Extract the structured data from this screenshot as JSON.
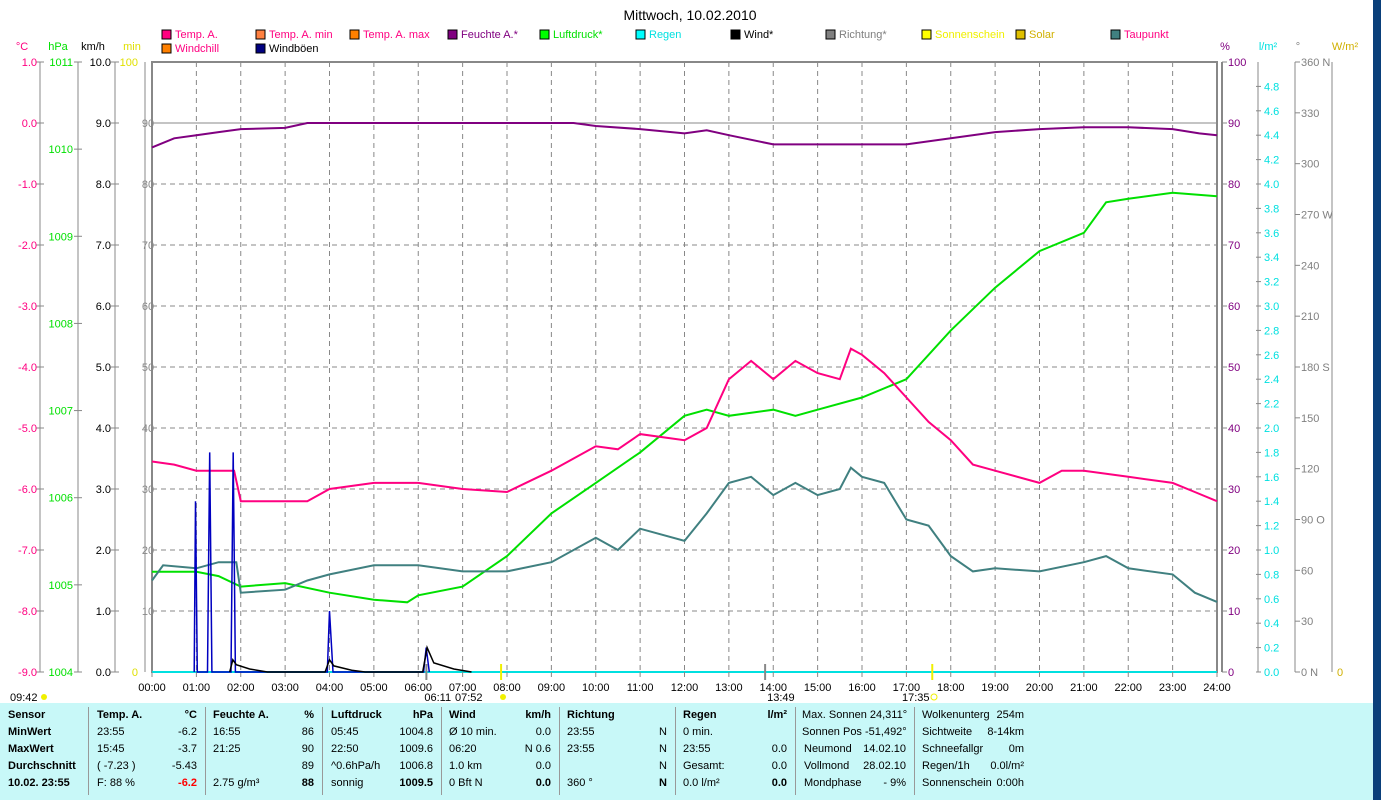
{
  "chart_data": {
    "type": "line",
    "title": "Mittwoch, 10.02.2010",
    "x_ticks": [
      "00:00",
      "01:00",
      "02:00",
      "03:00",
      "04:00",
      "05:00",
      "06:00",
      "07:00",
      "08:00",
      "09:00",
      "10:00",
      "11:00",
      "12:00",
      "13:00",
      "14:00",
      "15:00",
      "16:00",
      "17:00",
      "18:00",
      "19:00",
      "20:00",
      "21:00",
      "22:00",
      "23:00",
      "24:00"
    ],
    "xlim_hours": [
      0,
      24
    ],
    "legend": [
      {
        "name": "Temp. A.",
        "color": "#ff0080",
        "text": "#ff0080"
      },
      {
        "name": "Temp. A. min",
        "color": "#ff8040",
        "text": "#ff0080"
      },
      {
        "name": "Temp. A. max",
        "color": "#ff8000",
        "text": "#ff0080"
      },
      {
        "name": "Feuchte A.*",
        "color": "#800080",
        "text": "#800080"
      },
      {
        "name": "Luftdruck*",
        "color": "#00ff00",
        "text": "#00e000"
      },
      {
        "name": "Regen",
        "color": "#00ffff",
        "text": "#00e0e0"
      },
      {
        "name": "Wind*",
        "color": "#000000",
        "text": "#000000"
      },
      {
        "name": "Richtung*",
        "color": "#808080",
        "text": "#808080"
      },
      {
        "name": "Sonnenschein",
        "color": "#ffff00",
        "text": "#f0f000"
      },
      {
        "name": "Solar",
        "color": "#e0c000",
        "text": "#d0b000"
      },
      {
        "name": "Taupunkt",
        "color": "#408080",
        "text": "#ff0080"
      },
      {
        "name": "Windchill",
        "color": "#ff8000",
        "text": "#ff0080"
      },
      {
        "name": "Windböen",
        "color": "#000080",
        "text": "#000000"
      }
    ],
    "axes": {
      "temp": {
        "unit": "°C",
        "ylim": [
          -9,
          1
        ],
        "ticks": [
          "1.0",
          "0.0",
          "-1.0",
          "-2.0",
          "-3.0",
          "-4.0",
          "-5.0",
          "-6.0",
          "-7.0",
          "-8.0",
          "-9.0"
        ],
        "color": "#ff0080"
      },
      "pressure": {
        "unit": "hPa",
        "ylim": [
          1004,
          1011
        ],
        "ticks": [
          "1011",
          "1010",
          "1009",
          "1008",
          "1007",
          "1006",
          "1005",
          "1004"
        ],
        "color": "#00e000"
      },
      "wind": {
        "unit": "km/h",
        "ylim": [
          0,
          10
        ],
        "ticks": [
          "10.0",
          "9.0",
          "8.0",
          "7.0",
          "6.0",
          "5.0",
          "4.0",
          "3.0",
          "2.0",
          "1.0",
          "0.0"
        ],
        "color": "#000000"
      },
      "sun": {
        "unit": "min",
        "ylim": [
          0,
          100
        ],
        "ticks": [
          "100",
          "90",
          "80",
          "70",
          "60",
          "50",
          "40",
          "30",
          "20",
          "10",
          "0"
        ],
        "color": "#e0e000"
      },
      "humidity": {
        "unit": "%",
        "ylim": [
          0,
          100
        ],
        "ticks": [
          "100",
          "90",
          "80",
          "70",
          "60",
          "50",
          "40",
          "30",
          "20",
          "10",
          "0"
        ],
        "color": "#800080"
      },
      "rain": {
        "unit": "l/m²",
        "ylim": [
          0,
          5
        ],
        "ticks": [
          "4.8",
          "4.6",
          "4.4",
          "4.2",
          "4.0",
          "3.8",
          "3.6",
          "3.4",
          "3.2",
          "3.0",
          "2.8",
          "2.6",
          "2.4",
          "2.2",
          "2.0",
          "1.8",
          "1.6",
          "1.4",
          "1.2",
          "1.0",
          "0.8",
          "0.6",
          "0.4",
          "0.2",
          "0.0"
        ],
        "color": "#00e0e0"
      },
      "direction": {
        "unit": "°",
        "ylim": [
          0,
          360
        ],
        "ticks": [
          "360 N",
          "330",
          "300",
          "270 W",
          "240",
          "210",
          "180 S",
          "150",
          "120",
          "90  O",
          "60",
          "30",
          "0   N"
        ],
        "color": "#808080"
      },
      "solar": {
        "unit": "W/m²",
        "ticks": [
          "0"
        ],
        "color": "#d0b000"
      }
    },
    "series": [
      {
        "name": "Feuchte A.",
        "axis": "humidity",
        "color": "#800080",
        "x": [
          0,
          0.5,
          1,
          1.5,
          2,
          3,
          3.5,
          4,
          6,
          8,
          9.5,
          10,
          11,
          12,
          12.5,
          13,
          14,
          15,
          16,
          17,
          18,
          19,
          20,
          21,
          22,
          23,
          23.6,
          24
        ],
        "y": [
          86,
          87.5,
          88,
          88.5,
          89,
          89.2,
          90,
          90,
          90,
          90,
          90,
          89.5,
          89,
          88.3,
          88.8,
          88,
          86.5,
          86.5,
          86.5,
          86.5,
          87.5,
          88.5,
          89,
          89.3,
          89.3,
          89,
          88.3,
          88
        ]
      },
      {
        "name": "Luftdruck",
        "axis": "pressure",
        "color": "#00e000",
        "x": [
          0,
          1,
          1.5,
          2,
          3,
          4,
          5,
          5.75,
          6,
          7,
          8,
          9,
          10,
          11,
          12,
          12.5,
          13,
          14,
          14.5,
          15,
          16,
          17,
          18,
          19,
          20,
          21,
          21.5,
          22,
          23,
          24
        ],
        "y": [
          1005.15,
          1005.15,
          1005.1,
          1004.98,
          1005.02,
          1004.91,
          1004.83,
          1004.8,
          1004.88,
          1004.98,
          1005.33,
          1005.82,
          1006.17,
          1006.52,
          1006.94,
          1007.01,
          1006.94,
          1007.01,
          1006.94,
          1007.01,
          1007.15,
          1007.36,
          1007.92,
          1008.41,
          1008.83,
          1009.04,
          1009.39,
          1009.43,
          1009.5,
          1009.46
        ]
      },
      {
        "name": "Temp. A.",
        "axis": "temp",
        "color": "#ff0080",
        "x": [
          0,
          0.5,
          1,
          1.5,
          1.85,
          2,
          3,
          3.5,
          4,
          5,
          6,
          7,
          8,
          9,
          9.5,
          10,
          10.5,
          11,
          12,
          12.5,
          13,
          13.5,
          14,
          14.5,
          15,
          15.5,
          15.75,
          16,
          16.5,
          17,
          17.5,
          18,
          18.5,
          19,
          20,
          20.5,
          21,
          22,
          23,
          23.5,
          24
        ],
        "y": [
          -5.55,
          -5.6,
          -5.7,
          -5.7,
          -5.7,
          -6.2,
          -6.2,
          -6.2,
          -6.0,
          -5.9,
          -5.9,
          -6.0,
          -6.05,
          -5.7,
          -5.5,
          -5.3,
          -5.35,
          -5.1,
          -5.2,
          -5.0,
          -4.2,
          -3.9,
          -4.2,
          -3.9,
          -4.1,
          -4.2,
          -3.7,
          -3.8,
          -4.1,
          -4.5,
          -4.9,
          -5.2,
          -5.6,
          -5.7,
          -5.9,
          -5.7,
          -5.7,
          -5.8,
          -5.9,
          -6.05,
          -6.2
        ]
      },
      {
        "name": "Taupunkt",
        "axis": "temp",
        "color": "#408080",
        "x": [
          0,
          0.25,
          1,
          1.5,
          1.9,
          2,
          3,
          3.5,
          4,
          5,
          6,
          7,
          8,
          9,
          10,
          10.5,
          11,
          12,
          12.5,
          13,
          13.5,
          14,
          14.5,
          15,
          15.5,
          15.75,
          16,
          16.5,
          17,
          17.5,
          18,
          18.5,
          19,
          20,
          21,
          21.5,
          22,
          23,
          23.5,
          24
        ],
        "y": [
          -7.5,
          -7.25,
          -7.3,
          -7.2,
          -7.2,
          -7.7,
          -7.65,
          -7.5,
          -7.4,
          -7.25,
          -7.25,
          -7.35,
          -7.35,
          -7.2,
          -6.8,
          -7.0,
          -6.65,
          -6.85,
          -6.4,
          -5.9,
          -5.8,
          -6.1,
          -5.9,
          -6.1,
          -6.0,
          -5.65,
          -5.8,
          -5.9,
          -6.5,
          -6.6,
          -7.1,
          -7.35,
          -7.3,
          -7.35,
          -7.2,
          -7.1,
          -7.3,
          -7.4,
          -7.7,
          -7.85
        ]
      },
      {
        "name": "Windböen",
        "axis": "wind",
        "color": "#0000c0",
        "x": [
          0.95,
          0.98,
          1.02,
          1.25,
          1.3,
          1.35,
          1.78,
          1.83,
          1.88,
          3.95,
          4.0,
          4.08,
          6.12,
          6.18,
          6.25
        ],
        "y": [
          0,
          2.8,
          0,
          0,
          3.6,
          0,
          0,
          3.6,
          0,
          0,
          1.0,
          0,
          0,
          0.4,
          0
        ]
      },
      {
        "name": "Wind",
        "axis": "wind",
        "color": "#000000",
        "x": [
          1.75,
          1.82,
          1.9,
          2.2,
          2.6,
          3.9,
          4.0,
          4.1,
          4.5,
          4.8,
          6.1,
          6.2,
          6.35,
          6.8,
          7.2
        ],
        "y": [
          0,
          0.2,
          0.12,
          0.05,
          0,
          0,
          0.2,
          0.1,
          0.03,
          0,
          0,
          0.4,
          0.15,
          0.05,
          0
        ]
      }
    ],
    "sun_events": {
      "left": "09:42",
      "sunrise": "06:11",
      "sunrise2": "07:52",
      "noon": "13:49",
      "sunset": "17:35"
    }
  },
  "panel": {
    "columns": [
      {
        "rows": [
          [
            "Sensor",
            ""
          ],
          [
            "MinWert",
            ""
          ],
          [
            "MaxWert",
            ""
          ],
          [
            "Durchschnitt",
            ""
          ],
          [
            "10.02. 23:55",
            ""
          ]
        ],
        "bold": [
          0,
          1,
          2,
          3,
          4
        ]
      },
      {
        "rows": [
          [
            "Temp. A.",
            "°C"
          ],
          [
            "23:55",
            "-6.2"
          ],
          [
            "15:45",
            "-3.7"
          ],
          [
            "( -7.23 )",
            "-5.43"
          ],
          [
            "F: 88 %",
            "-6.2"
          ]
        ],
        "bold": [
          0
        ],
        "red": "-6.2"
      },
      {
        "rows": [
          [
            "Feuchte A.",
            "%"
          ],
          [
            "16:55",
            "86"
          ],
          [
            "21:25",
            "90"
          ],
          [
            "",
            "89"
          ],
          [
            "2.75 g/m³",
            "88"
          ]
        ],
        "bold": [
          0
        ]
      },
      {
        "rows": [
          [
            "Luftdruck",
            "hPa"
          ],
          [
            "05:45",
            "1004.8"
          ],
          [
            "22:50",
            "1009.6"
          ],
          [
            "^0.6hPa/h",
            "1006.8"
          ],
          [
            "sonnig",
            "1009.5"
          ]
        ],
        "bold": [
          0
        ]
      },
      {
        "rows": [
          [
            "Wind",
            "km/h"
          ],
          [
            "Ø 10 min.",
            "0.0"
          ],
          [
            "06:20",
            "N 0.6"
          ],
          [
            "1.0 km",
            "0.0"
          ],
          [
            "0 Bft N",
            "0.0"
          ]
        ],
        "bold": [
          0
        ]
      },
      {
        "rows": [
          [
            "Richtung",
            ""
          ],
          [
            "23:55",
            "N"
          ],
          [
            "23:55",
            "N"
          ],
          [
            "",
            "N"
          ],
          [
            "360 °",
            "N"
          ]
        ],
        "bold": [
          0
        ]
      },
      {
        "rows": [
          [
            "Regen",
            "l/m²"
          ],
          [
            "0 min.",
            ""
          ],
          [
            "23:55",
            "0.0"
          ],
          [
            "Gesamt:",
            "0.0"
          ],
          [
            "0.0 l/m²",
            "0.0"
          ]
        ],
        "bold": [
          0
        ]
      },
      {
        "rows": [
          [
            "Max. Sonnen 24,311°",
            ""
          ],
          [
            "Sonnen Pos -51,492°",
            ""
          ],
          [
            "Neumond",
            "14.02.10"
          ],
          [
            "Vollmond",
            "28.02.10"
          ],
          [
            "Mondphase",
            "- 9%"
          ]
        ],
        "bold": []
      },
      {
        "rows": [
          [
            "Wolkenunterg",
            "254m"
          ],
          [
            "Sichtweite",
            "8-14km"
          ],
          [
            "Schneefallgr",
            "0m"
          ],
          [
            "Regen/1h",
            "0.0l/m²"
          ],
          [
            "Sonnenschein",
            "0:00h"
          ]
        ],
        "bold": []
      }
    ]
  }
}
